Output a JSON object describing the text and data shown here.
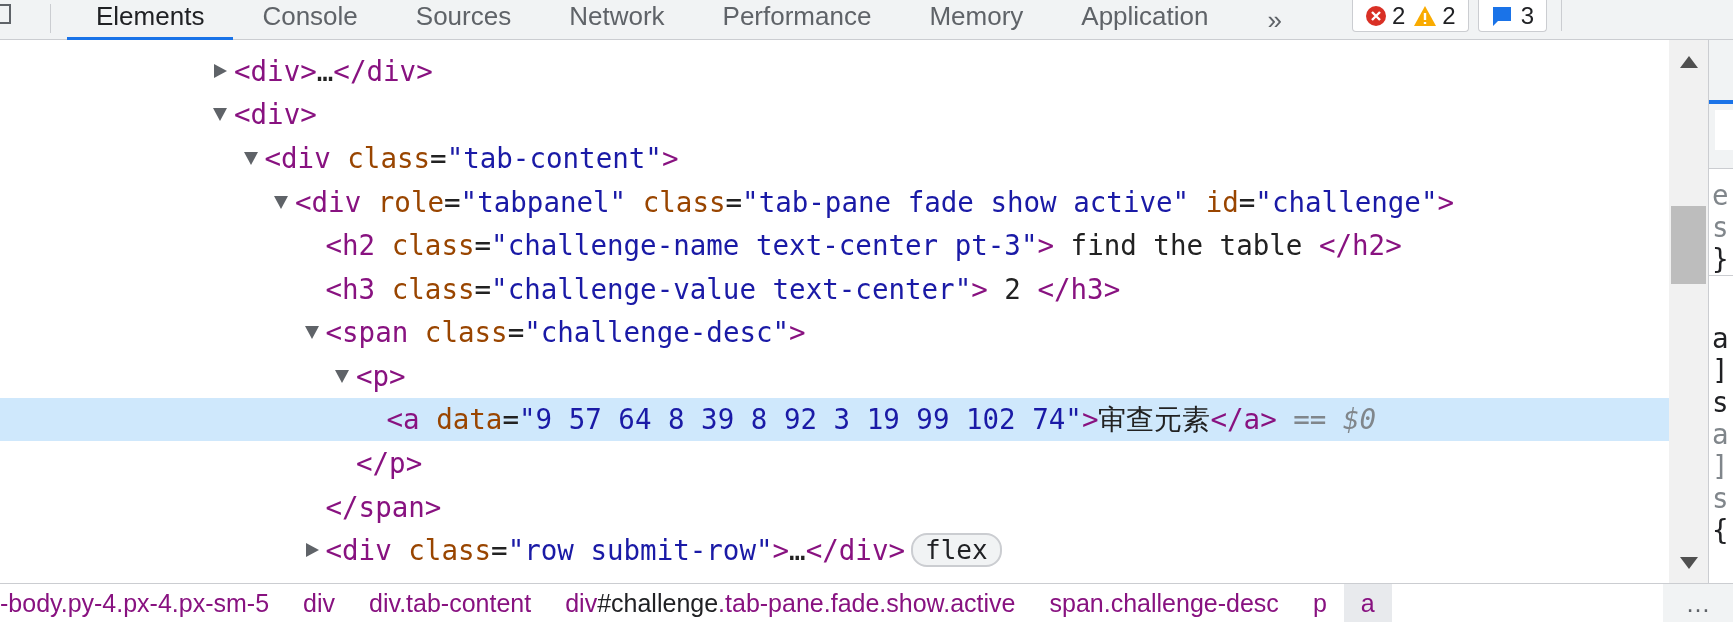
{
  "toolbar": {
    "tabs": [
      {
        "label": "Elements",
        "selected": true
      },
      {
        "label": "Console",
        "selected": false
      },
      {
        "label": "Sources",
        "selected": false
      },
      {
        "label": "Network",
        "selected": false
      },
      {
        "label": "Performance",
        "selected": false
      },
      {
        "label": "Memory",
        "selected": false
      },
      {
        "label": "Application",
        "selected": false
      }
    ],
    "more": "»",
    "issues": [
      {
        "kind": "error",
        "count": "2"
      },
      {
        "kind": "warning",
        "count": "2"
      }
    ],
    "messages": "3"
  },
  "dom_tree": [
    {
      "selected": false,
      "expanded": false,
      "tokens": [
        {
          "kind": "tag",
          "text": "<div>"
        },
        {
          "kind": "text",
          "text": "…"
        },
        {
          "kind": "tag",
          "text": "</div>"
        }
      ]
    },
    {
      "selected": false,
      "expanded": true,
      "tokens": [
        {
          "kind": "tag",
          "text": "<div>"
        }
      ],
      "children": [
        {
          "selected": false,
          "expanded": true,
          "tokens": [
            {
              "kind": "tag",
              "text": "<div"
            },
            {
              "kind": "attr",
              "text": " class"
            },
            {
              "kind": "punct",
              "text": "="
            },
            {
              "kind": "value",
              "text": "\"tab-content\""
            },
            {
              "kind": "tag",
              "text": ">"
            }
          ],
          "children": [
            {
              "selected": false,
              "expanded": true,
              "tokens": [
                {
                  "kind": "tag",
                  "text": "<div"
                },
                {
                  "kind": "attr",
                  "text": " role"
                },
                {
                  "kind": "punct",
                  "text": "="
                },
                {
                  "kind": "value",
                  "text": "\"tabpanel\""
                },
                {
                  "kind": "attr",
                  "text": " class"
                },
                {
                  "kind": "punct",
                  "text": "="
                },
                {
                  "kind": "value",
                  "text": "\"tab-pane fade show active\""
                },
                {
                  "kind": "attr",
                  "text": " id"
                },
                {
                  "kind": "punct",
                  "text": "="
                },
                {
                  "kind": "value",
                  "text": "\"challenge\""
                },
                {
                  "kind": "tag",
                  "text": ">"
                }
              ],
              "children": [
                {
                  "selected": false,
                  "tokens": [
                    {
                      "kind": "tag",
                      "text": "<h2"
                    },
                    {
                      "kind": "attr",
                      "text": " class"
                    },
                    {
                      "kind": "punct",
                      "text": "="
                    },
                    {
                      "kind": "value",
                      "text": "\"challenge-name text-center pt-3\""
                    },
                    {
                      "kind": "tag",
                      "text": ">"
                    },
                    {
                      "kind": "text",
                      "text": " find the table "
                    },
                    {
                      "kind": "tag",
                      "text": "</h2>"
                    }
                  ]
                },
                {
                  "selected": false,
                  "tokens": [
                    {
                      "kind": "tag",
                      "text": "<h3"
                    },
                    {
                      "kind": "attr",
                      "text": " class"
                    },
                    {
                      "kind": "punct",
                      "text": "="
                    },
                    {
                      "kind": "value",
                      "text": "\"challenge-value text-center\""
                    },
                    {
                      "kind": "tag",
                      "text": ">"
                    },
                    {
                      "kind": "text",
                      "text": " 2 "
                    },
                    {
                      "kind": "tag",
                      "text": "</h3>"
                    }
                  ]
                },
                {
                  "selected": false,
                  "expanded": true,
                  "tokens": [
                    {
                      "kind": "tag",
                      "text": "<span"
                    },
                    {
                      "kind": "attr",
                      "text": " class"
                    },
                    {
                      "kind": "punct",
                      "text": "="
                    },
                    {
                      "kind": "value",
                      "text": "\"challenge-desc\""
                    },
                    {
                      "kind": "tag",
                      "text": ">"
                    }
                  ],
                  "closing": [
                    {
                      "kind": "tag",
                      "text": "</span>"
                    }
                  ],
                  "children": [
                    {
                      "selected": false,
                      "expanded": true,
                      "tokens": [
                        {
                          "kind": "tag",
                          "text": "<p>"
                        }
                      ],
                      "closing": [
                        {
                          "kind": "tag",
                          "text": "</p>"
                        }
                      ],
                      "children": [
                        {
                          "selected": true,
                          "tokens": [
                            {
                              "kind": "tag",
                              "text": "<a"
                            },
                            {
                              "kind": "attr",
                              "text": " data"
                            },
                            {
                              "kind": "punct",
                              "text": "="
                            },
                            {
                              "kind": "value",
                              "text": "\"9 57 64 8 39 8 92 3 19 99 102 74\""
                            },
                            {
                              "kind": "tag",
                              "text": ">"
                            },
                            {
                              "kind": "text",
                              "text": "审查元素"
                            },
                            {
                              "kind": "tag",
                              "text": "</a>"
                            },
                            {
                              "kind": "hint",
                              "text": " == $0"
                            }
                          ]
                        }
                      ]
                    }
                  ]
                },
                {
                  "selected": false,
                  "expanded": false,
                  "badge": "flex",
                  "tokens": [
                    {
                      "kind": "tag",
                      "text": "<div"
                    },
                    {
                      "kind": "attr",
                      "text": " class"
                    },
                    {
                      "kind": "punct",
                      "text": "="
                    },
                    {
                      "kind": "value",
                      "text": "\"row submit-row\""
                    },
                    {
                      "kind": "tag",
                      "text": ">"
                    },
                    {
                      "kind": "text",
                      "text": "…"
                    },
                    {
                      "kind": "tag",
                      "text": "</div>"
                    }
                  ]
                }
              ]
            }
          ]
        }
      ]
    }
  ],
  "styles_pane": {
    "blocks": [
      [
        {
          "text": "e",
          "dim": true
        },
        {
          "text": "s",
          "dim": true
        },
        {
          "text": "}",
          "dim": false
        }
      ],
      [
        {
          "text": "a",
          "dim": false
        },
        {
          "text": "]",
          "dim": false
        },
        {
          "text": "s",
          "dim": false
        },
        {
          "text": "a",
          "dim": true
        },
        {
          "text": "]",
          "dim": true
        },
        {
          "text": "s",
          "dim": true
        },
        {
          "text": "{",
          "dim": false
        }
      ]
    ]
  },
  "breadcrumbs": {
    "items": [
      {
        "selected": false,
        "tag": "-body",
        "rest": ".py-4.px-4.px-sm-5"
      },
      {
        "selected": false,
        "tag": "div"
      },
      {
        "selected": false,
        "tag": "div",
        "rest": ".tab-content"
      },
      {
        "selected": false,
        "tag": "div",
        "id": "#challenge",
        "rest": ".tab-pane.fade.show.active"
      },
      {
        "selected": false,
        "tag": "span",
        "rest": ".challenge-desc"
      },
      {
        "selected": false,
        "tag": "p"
      },
      {
        "selected": true,
        "tag": "a"
      }
    ],
    "overflow": "…"
  }
}
